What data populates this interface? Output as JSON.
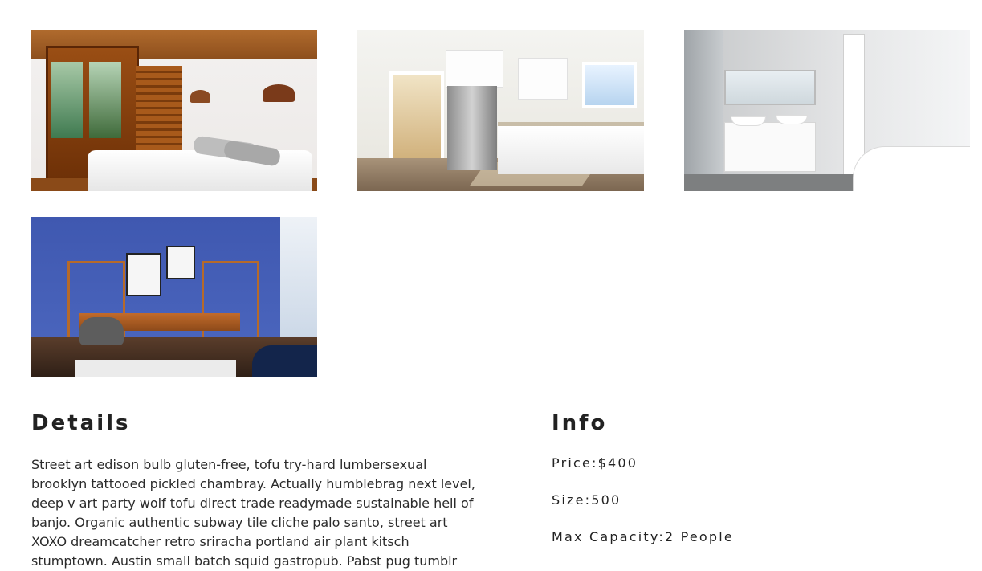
{
  "gallery": {
    "photos": [
      {
        "name": "bedroom-photo",
        "icon": "bedroom-photo"
      },
      {
        "name": "kitchen-photo",
        "icon": "kitchen-photo"
      },
      {
        "name": "bathroom-photo",
        "icon": "bathroom-photo"
      },
      {
        "name": "office-photo",
        "icon": "office-photo"
      }
    ]
  },
  "details": {
    "title": "Details",
    "text": "Street art edison bulb gluten-free, tofu try-hard lumbersexual brooklyn tattooed pickled chambray. Actually humblebrag next level, deep v art party wolf tofu direct trade readymade sustainable hell of banjo. Organic authentic subway tile cliche palo santo, street art XOXO dreamcatcher retro sriracha portland air plant kitsch stumptown. Austin small batch squid gastropub. Pabst pug tumblr"
  },
  "info": {
    "title": "Info",
    "items": [
      {
        "label": "Price",
        "value": "$400"
      },
      {
        "label": "Size",
        "value": "500"
      },
      {
        "label": "Max Capacity",
        "value": "2 People"
      }
    ]
  }
}
